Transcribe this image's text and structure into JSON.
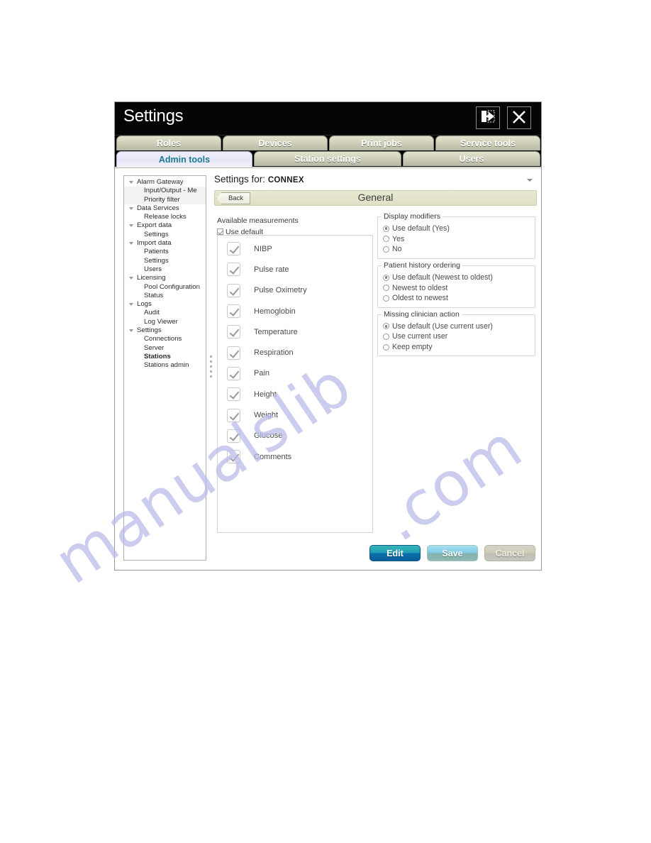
{
  "window": {
    "title": "Settings",
    "exit_icon": "exit-icon",
    "close_icon": "close-icon"
  },
  "tabs": {
    "row1": [
      {
        "label": "Roles",
        "active": false
      },
      {
        "label": "Devices",
        "active": false
      },
      {
        "label": "Print jobs",
        "active": false
      },
      {
        "label": "Service tools",
        "active": false
      }
    ],
    "row2": [
      {
        "label": "Admin tools",
        "active": true
      },
      {
        "label": "Station settings",
        "active": false
      },
      {
        "label": "Users",
        "active": false
      }
    ]
  },
  "tree": [
    {
      "label": "Alarm Gateway",
      "level": "root",
      "expanded": true,
      "selected": false
    },
    {
      "label": "Input/Output - Me",
      "level": "child",
      "expanded": false,
      "selected": false
    },
    {
      "label": "Priority filter",
      "level": "child",
      "expanded": false,
      "selected": false
    },
    {
      "label": "Data Services",
      "level": "root",
      "expanded": true,
      "selected": false
    },
    {
      "label": "Release locks",
      "level": "child",
      "expanded": false,
      "selected": false
    },
    {
      "label": "Export data",
      "level": "root",
      "expanded": true,
      "selected": false
    },
    {
      "label": "Settings",
      "level": "child",
      "expanded": false,
      "selected": false
    },
    {
      "label": "Import data",
      "level": "root",
      "expanded": true,
      "selected": false
    },
    {
      "label": "Patients",
      "level": "child",
      "expanded": false,
      "selected": false
    },
    {
      "label": "Settings",
      "level": "child",
      "expanded": false,
      "selected": false
    },
    {
      "label": "Users",
      "level": "child",
      "expanded": false,
      "selected": false
    },
    {
      "label": "Licensing",
      "level": "root",
      "expanded": true,
      "selected": false
    },
    {
      "label": "Pool Configuration",
      "level": "child",
      "expanded": false,
      "selected": false
    },
    {
      "label": "Status",
      "level": "child",
      "expanded": false,
      "selected": false
    },
    {
      "label": "Logs",
      "level": "root",
      "expanded": true,
      "selected": false
    },
    {
      "label": "Audit",
      "level": "child",
      "expanded": false,
      "selected": false
    },
    {
      "label": "Log Viewer",
      "level": "child",
      "expanded": false,
      "selected": false
    },
    {
      "label": "Settings",
      "level": "root",
      "expanded": true,
      "selected": false
    },
    {
      "label": "Connections",
      "level": "child",
      "expanded": false,
      "selected": false
    },
    {
      "label": "Server",
      "level": "child",
      "expanded": false,
      "selected": false
    },
    {
      "label": "Stations",
      "level": "child",
      "expanded": false,
      "selected": true
    },
    {
      "label": "Stations admin",
      "level": "child",
      "expanded": false,
      "selected": false
    }
  ],
  "content": {
    "settings_for_label": "Settings for:",
    "settings_for_value": "CONNEX",
    "dropdown_icon": "chevron-down-icon",
    "back_label": "Back",
    "page_title": "General"
  },
  "available_measurements": {
    "group_label": "Available measurements",
    "use_default_label": "Use default",
    "use_default_checked": true,
    "items": [
      {
        "label": "NIBP",
        "checked": true
      },
      {
        "label": "Pulse rate",
        "checked": true
      },
      {
        "label": "Pulse Oximetry",
        "checked": true
      },
      {
        "label": "Hemoglobin",
        "checked": true
      },
      {
        "label": "Temperature",
        "checked": true
      },
      {
        "label": "Respiration",
        "checked": true
      },
      {
        "label": "Pain",
        "checked": true
      },
      {
        "label": "Height",
        "checked": true
      },
      {
        "label": "Weight",
        "checked": true
      },
      {
        "label": "Glucose",
        "checked": true
      },
      {
        "label": "Comments",
        "checked": true
      }
    ]
  },
  "radio_groups": [
    {
      "legend": "Display modifiers",
      "options": [
        {
          "label": "Use default (Yes)",
          "selected": true
        },
        {
          "label": "Yes",
          "selected": false
        },
        {
          "label": "No",
          "selected": false
        }
      ]
    },
    {
      "legend": "Patient history ordering",
      "options": [
        {
          "label": "Use default (Newest to oldest)",
          "selected": true
        },
        {
          "label": "Newest to oldest",
          "selected": false
        },
        {
          "label": "Oldest to newest",
          "selected": false
        }
      ]
    },
    {
      "legend": "Missing clinician action",
      "options": [
        {
          "label": "Use default (Use current user)",
          "selected": true
        },
        {
          "label": "Use current user",
          "selected": false
        },
        {
          "label": "Keep empty",
          "selected": false
        }
      ]
    }
  ],
  "footer": {
    "edit_label": "Edit",
    "save_label": "Save",
    "cancel_label": "Cancel"
  },
  "watermark": {
    "line1": "manualslib",
    "line2": ".com"
  }
}
